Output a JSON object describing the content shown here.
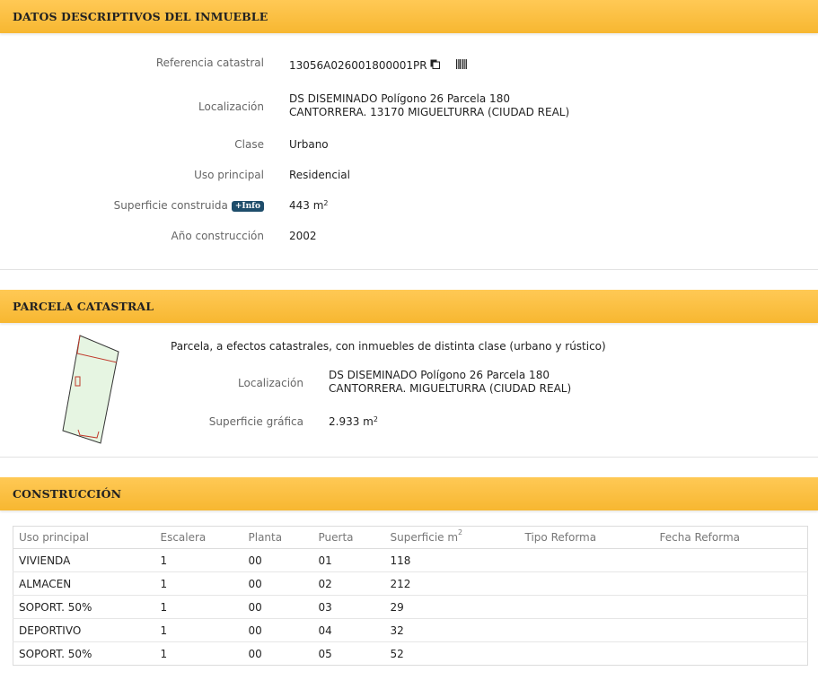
{
  "datos": {
    "title": "DATOS DESCRIPTIVOS DEL INMUEBLE",
    "referencia_label": "Referencia catastral",
    "referencia_value": "13056A026001800001PR",
    "localizacion_label": "Localización",
    "localizacion_line1": "DS DISEMINADO Polígono 26 Parcela 180",
    "localizacion_line2": "CANTORRERA. 13170 MIGUELTURRA (CIUDAD REAL)",
    "clase_label": "Clase",
    "clase_value": "Urbano",
    "uso_label": "Uso principal",
    "uso_value": "Residencial",
    "superficie_label": "Superficie construida",
    "info_badge": "+Info",
    "superficie_value": "443 m",
    "superficie_unit_sup": "2",
    "anio_label": "Año construcción",
    "anio_value": "2002"
  },
  "parcela": {
    "title": "PARCELA CATASTRAL",
    "description": "Parcela, a efectos catastrales, con inmuebles de distinta clase (urbano y rústico)",
    "localizacion_label": "Localización",
    "localizacion_line1": "DS DISEMINADO Polígono 26 Parcela 180",
    "localizacion_line2": "CANTORRERA. MIGUELTURRA (CIUDAD REAL)",
    "superficie_label": "Superficie gráfica",
    "superficie_value": "2.933 m",
    "superficie_unit_sup": "2"
  },
  "construccion": {
    "title": "CONSTRUCCIÓN",
    "columns": [
      "Uso principal",
      "Escalera",
      "Planta",
      "Puerta",
      "Superficie m",
      "Tipo Reforma",
      "Fecha Reforma"
    ],
    "superficie_col_sup": "2",
    "rows": [
      [
        "VIVIENDA",
        "1",
        "00",
        "01",
        "118",
        "",
        ""
      ],
      [
        "ALMACEN",
        "1",
        "00",
        "02",
        "212",
        "",
        ""
      ],
      [
        "SOPORT. 50%",
        "1",
        "00",
        "03",
        "29",
        "",
        ""
      ],
      [
        "DEPORTIVO",
        "1",
        "00",
        "04",
        "32",
        "",
        ""
      ],
      [
        "SOPORT. 50%",
        "1",
        "00",
        "05",
        "52",
        "",
        ""
      ]
    ]
  },
  "icons": {
    "copy": "copy-icon",
    "barcode": "barcode-icon",
    "parcel_map": "parcel-map-icon"
  },
  "colors": {
    "header_bg": "#f7b731",
    "badge_bg": "#1e4d6b"
  }
}
